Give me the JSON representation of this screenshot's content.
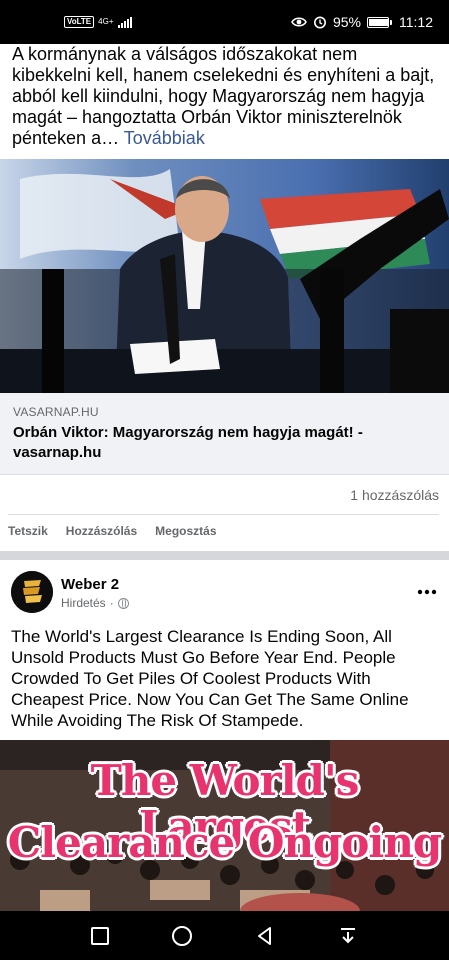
{
  "status_bar": {
    "volte": "VoLTE",
    "network": "4G+",
    "battery": "95%",
    "battery_level": 0.95,
    "time": "11:12"
  },
  "post1": {
    "text": "A kormánynak a válságos időszakokat nem kibekkelni kell, hanem cselekedni és enyhíteni a bajt, abból kell kiindulni, hogy Magyarország nem hagyja magát – hangoztatta Orbán Viktor miniszterelnök pénteken a… ",
    "more_label": "Továbbiak",
    "link_domain": "VASARNAP.HU",
    "link_title": "Orbán Viktor: Magyarország nem hagyja magát! - vasarnap.hu",
    "comments_count": "1 hozzászólás",
    "actions": {
      "like": "Tetszik",
      "comment": "Hozzászólás",
      "share": "Megosztás"
    }
  },
  "post2": {
    "author": "Weber 2",
    "sponsored": "Hirdetés",
    "more_icon": "more-dots-icon",
    "text": "The World's Largest Clearance Is Ending Soon, All Unsold Products Must Go Before Year End. People Crowded To Get Piles Of Coolest Products With Cheapest Price. Now You Can Get The Same Online While Avoiding The Risk Of Stampede.",
    "ad_line1": "The World's Largest",
    "ad_line2": "Clearance Ongoing"
  },
  "colors": {
    "link_blue": "#385898",
    "secondary_text": "#65676b",
    "ad_pink": "#e8346e"
  }
}
